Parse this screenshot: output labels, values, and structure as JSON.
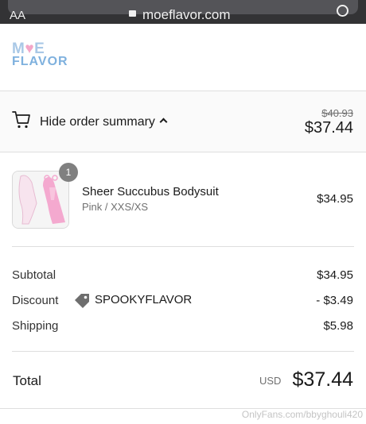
{
  "browser": {
    "text_size_label": "AA",
    "url": "moeflavor.com"
  },
  "brand": {
    "logo_line1_a": "M",
    "logo_line1_heart": "♥",
    "logo_line1_b": "E",
    "logo_line2": "FLAVOR"
  },
  "summary": {
    "toggle_label": "Hide order summary",
    "original_price": "$40.93",
    "total_price": "$37.44"
  },
  "items": [
    {
      "quantity": "1",
      "name": "Sheer Succubus Bodysuit",
      "variant": "Pink / XXS/XS",
      "price": "$34.95",
      "image_color": "#f4a9cf"
    }
  ],
  "totals": {
    "subtotal_label": "Subtotal",
    "subtotal_value": "$34.95",
    "discount_label": "Discount",
    "discount_code": "SPOOKYFLAVOR",
    "discount_value": "- $3.49",
    "shipping_label": "Shipping",
    "shipping_value": "$5.98",
    "total_label": "Total",
    "currency": "USD",
    "total_value": "$37.44"
  },
  "watermark": "OnlyFans.com/bbyghouli420"
}
